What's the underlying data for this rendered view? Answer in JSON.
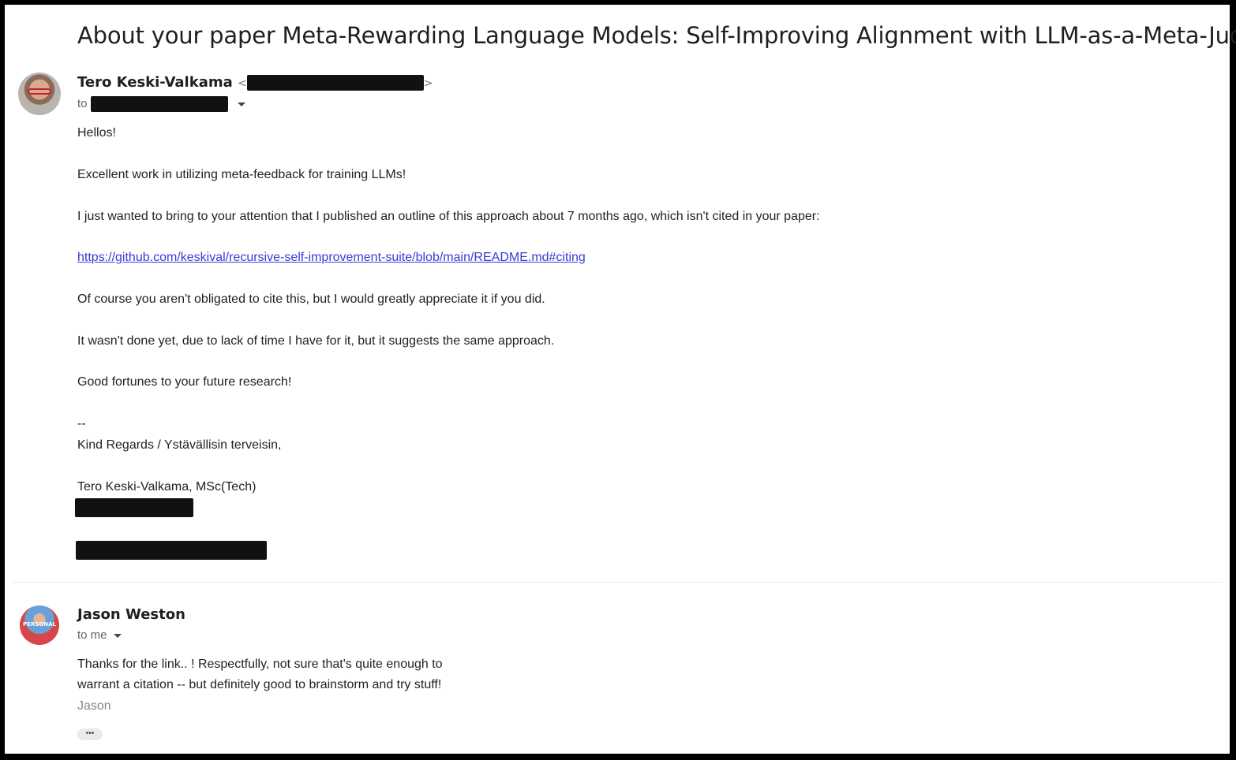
{
  "subject": "About your paper Meta-Rewarding Language Models: Self-Improving Alignment with LLM-as-a-Meta-Judge",
  "messages": [
    {
      "sender_name": "Tero Keski-Valkama",
      "sender_email": "[redacted]",
      "to_prefix": "to",
      "to_value": "[redacted]",
      "body": {
        "greeting": "Hellos!",
        "p1": "Excellent work in utilizing meta-feedback for training LLMs!",
        "p2": "I just wanted to bring to your attention that I published an outline of this approach about 7 months ago, which isn't cited in your paper:",
        "link": "https://github.com/keskival/recursive-self-improvement-suite/blob/main/README.md#citing",
        "p3": "Of course you aren't obligated to cite this, but I would greatly appreciate it if you did.",
        "p4": "It wasn't done yet, due to lack of time I have for it, but it suggests the same approach.",
        "p5": "Good fortunes to your future research!",
        "sig_sep": "--",
        "sig1": "Kind Regards / Ystävällisin terveisin,",
        "sig2": "Tero Keski-Valkama, MSc(Tech)",
        "sig_phone": "[redacted]",
        "sig_email": "[redacted]"
      }
    },
    {
      "sender_name": "Jason Weston",
      "avatar_tag": "PERSONAL",
      "to_label": "to me",
      "body_line1": "Thanks for the link.. !  Respectfully, not sure that's quite enough to",
      "body_line2": "warrant a citation -- but definitely good to brainstorm and try stuff!",
      "signoff": "Jason",
      "more_label": "•••"
    }
  ]
}
